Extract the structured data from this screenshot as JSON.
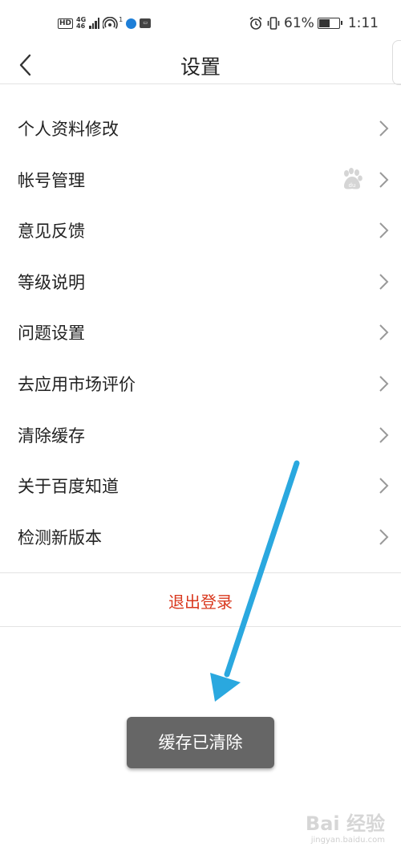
{
  "status_bar": {
    "hd_badge": "HD",
    "network_top": "4G",
    "network_bottom": "46",
    "hotspot_sup": "1",
    "battery_percent": "61%",
    "battery_level": 0.61,
    "time": "1:11",
    "icons": [
      "hd-icon",
      "signal-icon",
      "hotspot-icon",
      "browser-icon",
      "app-icon",
      "alarm-icon",
      "vibrate-icon",
      "battery-icon"
    ]
  },
  "nav": {
    "title": "设置",
    "back_icon": "chevron-left-icon"
  },
  "menu": {
    "items": [
      {
        "label": "个人资料修改"
      },
      {
        "label": "帐号管理",
        "extra_icon": "baidu-paw-icon"
      },
      {
        "label": "意见反馈"
      },
      {
        "label": "等级说明"
      },
      {
        "label": "问题设置"
      },
      {
        "label": "去应用市场评价"
      },
      {
        "label": "清除缓存"
      },
      {
        "label": "关于百度知道"
      },
      {
        "label": "检测新版本"
      }
    ],
    "chevron_icon": "chevron-right-icon"
  },
  "logout_label": "退出登录",
  "toast_text": "缓存已清除",
  "watermark": {
    "main": "Bai 经验",
    "sub": "jingyan.baidu.com"
  },
  "colors": {
    "logout": "#d9381e",
    "toast_bg": "#666666",
    "annotation_arrow": "#2aa8df"
  }
}
